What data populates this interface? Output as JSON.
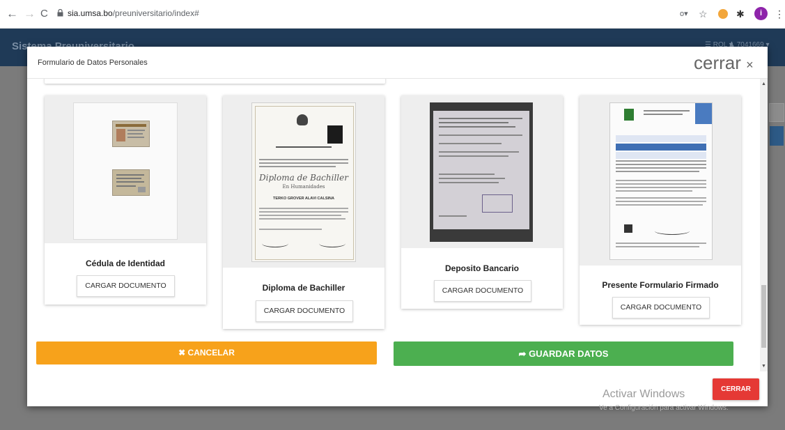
{
  "browser": {
    "back_icon": "←",
    "forward_icon": "→",
    "reload_icon": "C",
    "url_host": "sia.umsa.bo",
    "url_path": "/preuniversitario/index#",
    "key_icon": "o▾",
    "star_icon": "☆",
    "extension_icon": "✱",
    "profile_letter": "i",
    "menu_icon": "⋮"
  },
  "app": {
    "title": "Sistema Preuniversitario",
    "rol": "☰ ROL ▾",
    "user": "♟ 7041669 ▾"
  },
  "modal": {
    "title": "Formulario de Datos Personales",
    "close_label": "cerrar",
    "close_icon": "×",
    "documents": [
      {
        "label": "Cédula de Identidad",
        "button": "CARGAR DOCUMENTO"
      },
      {
        "label": "Diploma de Bachiller",
        "button": "CARGAR DOCUMENTO",
        "diploma_heading": "Diploma de Bachiller",
        "diploma_subheading": "En Humanidades",
        "diploma_name": "TERKO GROVER ALAVI CALSINA"
      },
      {
        "label": "Deposito Bancario",
        "button": "CARGAR DOCUMENTO"
      },
      {
        "label": "Presente Formulario Firmado",
        "button": "CARGAR DOCUMENTO"
      }
    ],
    "cancel_icon": "✖",
    "cancel_label": "CANCELAR",
    "save_icon": "➦",
    "save_label": "GUARDAR DATOS",
    "close_button": "CERRAR"
  },
  "watermark": {
    "line1": "Activar Windows",
    "line2": "Ve a Configuración para activar Windows."
  }
}
